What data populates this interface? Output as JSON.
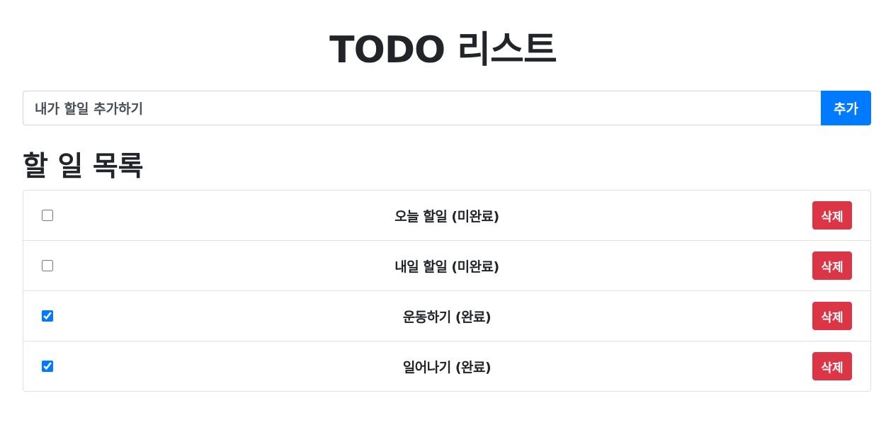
{
  "header": {
    "title": "TODO 리스트"
  },
  "add_form": {
    "input_value": "내가 할일 추가하기",
    "add_label": "추가"
  },
  "list": {
    "title": "할 일 목록",
    "items": [
      {
        "text": "오늘 할일 (미완료)",
        "checked": false,
        "delete_label": "삭제"
      },
      {
        "text": "내일 할일 (미완료)",
        "checked": false,
        "delete_label": "삭제"
      },
      {
        "text": "운동하기 (완료)",
        "checked": true,
        "delete_label": "삭제"
      },
      {
        "text": "일어나기 (완료)",
        "checked": true,
        "delete_label": "삭제"
      }
    ]
  },
  "colors": {
    "primary": "#007bff",
    "danger": "#dc3545",
    "border": "#dee2e6",
    "text": "#212529"
  }
}
